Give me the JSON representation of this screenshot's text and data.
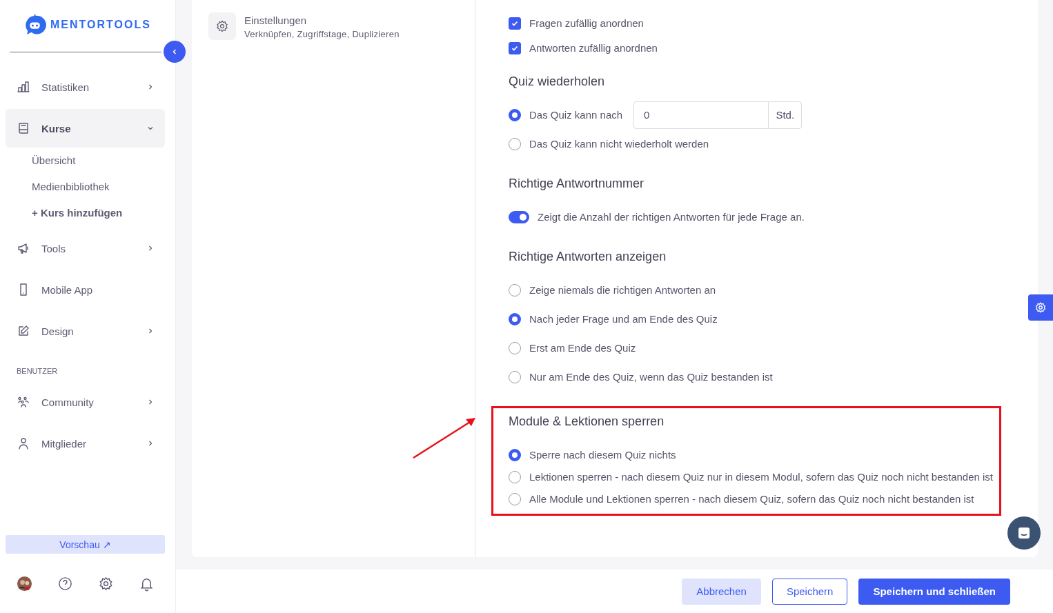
{
  "sidebar": {
    "logo": "MENTORTOOLS",
    "items": [
      {
        "label": "Statistiken",
        "kind": "submenu",
        "expanded": false,
        "selected": false
      },
      {
        "label": "Kurse",
        "kind": "submenu",
        "expanded": true,
        "selected": true,
        "children": [
          {
            "label": "Übersicht",
            "kind": "link"
          },
          {
            "label": "Medienbibliothek",
            "kind": "link"
          },
          {
            "label": "+ Kurs hinzufügen",
            "kind": "add"
          }
        ]
      },
      {
        "label": "Tools",
        "kind": "submenu",
        "expanded": false,
        "selected": false
      },
      {
        "label": "Mobile App",
        "kind": "link",
        "selected": false
      },
      {
        "label": "Design",
        "kind": "submenu",
        "expanded": false,
        "selected": false
      }
    ],
    "section_label": "BENUTZER",
    "user_items": [
      {
        "label": "Community",
        "kind": "submenu",
        "expanded": false,
        "selected": false
      },
      {
        "label": "Mitglieder",
        "kind": "submenu",
        "expanded": false,
        "selected": false
      }
    ],
    "preview_button": "Vorschau ↗"
  },
  "settings_nav": {
    "title": "Einstellungen",
    "subtitle": "Verknüpfen, Zugriffstage, Duplizieren"
  },
  "sections": [
    {
      "highlighted": false,
      "controls": [
        {
          "kind": "checkbox",
          "label": "Fragen zufällig anordnen",
          "checked": true
        },
        {
          "kind": "checkbox",
          "label": "Antworten zufällig anordnen",
          "checked": true
        }
      ]
    },
    {
      "title": "Quiz wiederholen",
      "highlighted": false,
      "controls": [
        {
          "kind": "radio_input",
          "label": "Das Quiz kann nach",
          "selected": true,
          "value": "0",
          "unit": "Std."
        },
        {
          "kind": "radio",
          "label": "Das Quiz kann nicht wiederholt werden",
          "selected": false
        }
      ]
    },
    {
      "title": "Richtige Antwortnummer",
      "highlighted": false,
      "controls": [
        {
          "kind": "toggle",
          "label": "Zeigt die Anzahl der richtigen Antworten für jede Frage an.",
          "on": true
        }
      ]
    },
    {
      "title": "Richtige Antworten anzeigen",
      "highlighted": false,
      "controls": [
        {
          "kind": "radio",
          "label": "Zeige niemals die richtigen Antworten an",
          "selected": false
        },
        {
          "kind": "radio",
          "label": "Nach jeder Frage und am Ende des Quiz",
          "selected": true
        },
        {
          "kind": "radio",
          "label": "Erst am Ende des Quiz",
          "selected": false
        },
        {
          "kind": "radio",
          "label": "Nur am Ende des Quiz, wenn das Quiz bestanden ist",
          "selected": false
        }
      ]
    },
    {
      "title": "Module & Lektionen sperren",
      "highlighted": true,
      "controls": [
        {
          "kind": "radio",
          "label": "Sperre nach diesem Quiz nichts",
          "selected": true
        },
        {
          "kind": "radio",
          "label": "Lektionen sperren - nach diesem Quiz nur in diesem Modul, sofern das Quiz noch nicht bestanden ist",
          "selected": false
        },
        {
          "kind": "radio",
          "label": "Alle Module und Lektionen sperren - nach diesem Quiz, sofern das Quiz noch nicht bestanden ist",
          "selected": false
        }
      ]
    }
  ],
  "footer_buttons": [
    {
      "label": "Abbrechen",
      "kind": "secondary"
    },
    {
      "label": "Speichern",
      "kind": "outline"
    },
    {
      "label": "Speichern und schließen",
      "kind": "primary"
    }
  ]
}
